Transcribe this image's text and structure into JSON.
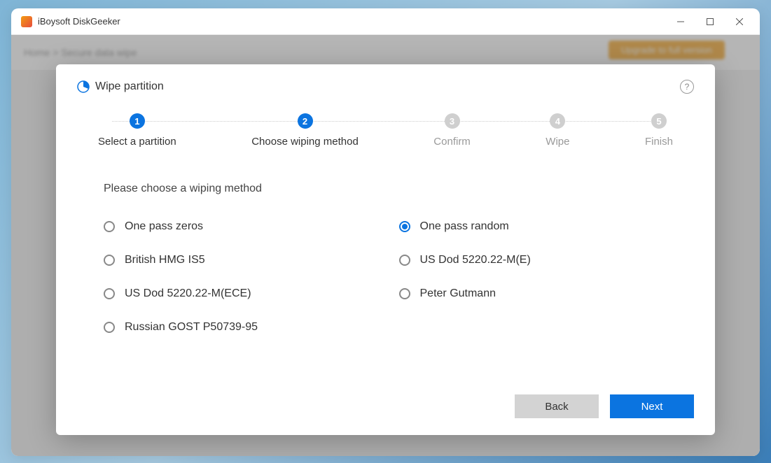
{
  "app": {
    "title": "iBoysoft DiskGeeker"
  },
  "background": {
    "breadcrumb_home": "Home",
    "breadcrumb_sep": ">",
    "breadcrumb_page": "Secure data wipe",
    "upgrade_label": "Upgrade to full version"
  },
  "modal": {
    "title": "Wipe partition",
    "help_label": "?",
    "steps": [
      {
        "num": "1",
        "label": "Select a partition",
        "state": "done"
      },
      {
        "num": "2",
        "label": "Choose wiping method",
        "state": "active"
      },
      {
        "num": "3",
        "label": "Confirm",
        "state": "pending"
      },
      {
        "num": "4",
        "label": "Wipe",
        "state": "pending"
      },
      {
        "num": "5",
        "label": "Finish",
        "state": "pending"
      }
    ],
    "prompt": "Please choose a wiping method",
    "options": [
      {
        "label": "One pass zeros",
        "selected": false
      },
      {
        "label": "One pass random",
        "selected": true
      },
      {
        "label": "British HMG IS5",
        "selected": false
      },
      {
        "label": "US Dod 5220.22-M(E)",
        "selected": false
      },
      {
        "label": "US Dod 5220.22-M(ECE)",
        "selected": false
      },
      {
        "label": "Peter Gutmann",
        "selected": false
      },
      {
        "label": "Russian GOST P50739-95",
        "selected": false
      }
    ],
    "back_label": "Back",
    "next_label": "Next"
  },
  "colors": {
    "accent": "#0b74e0",
    "inactive": "#cfcfcf",
    "upgrade": "#f39c12"
  }
}
